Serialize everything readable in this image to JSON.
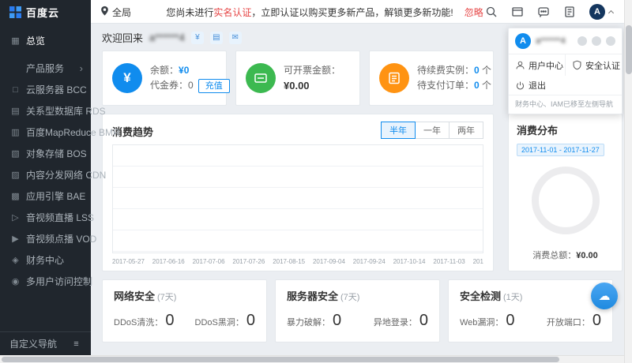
{
  "topbar": {
    "logo": "百度云",
    "region": "全局",
    "notice": {
      "prefix": "您尚未进行",
      "link": "实名认证",
      "body": "，立即认证以购买更多新产品，解锁更多新功能!",
      "ignore": "忽略"
    },
    "avatar": "A"
  },
  "sidebar": {
    "items": [
      {
        "icon": "▦",
        "label": "总览"
      },
      {
        "icon": "",
        "label": "产品服务",
        "chevron": "›"
      },
      {
        "icon": "□",
        "label": "云服务器 BCC"
      },
      {
        "icon": "▤",
        "label": "关系型数据库 RDS"
      },
      {
        "icon": "▥",
        "label": "百度MapReduce BMR"
      },
      {
        "icon": "▧",
        "label": "对象存储 BOS"
      },
      {
        "icon": "▨",
        "label": "内容分发网络 CDN"
      },
      {
        "icon": "▩",
        "label": "应用引擎 BAE"
      },
      {
        "icon": "▷",
        "label": "音视频直播 LSS"
      },
      {
        "icon": "▶",
        "label": "音视频点播 VOD"
      },
      {
        "icon": "◈",
        "label": "财务中心"
      },
      {
        "icon": "◉",
        "label": "多用户访问控制"
      }
    ],
    "footer": {
      "label": "自定义导航",
      "icon": "≡"
    }
  },
  "welcome": {
    "greeting": "欢迎回来",
    "username": "a******4"
  },
  "user_menu": {
    "avatar": "A",
    "username": "a******4",
    "items": {
      "user_center": "用户中心",
      "security": "安全认证",
      "logout": "退出"
    },
    "note": "财务中心、IAM已移至左侧导航"
  },
  "stats": {
    "balance": {
      "currency_icon": "¥",
      "label": "余额：",
      "value": "¥0",
      "voucher_label": "代金券：",
      "voucher_value": "0",
      "recharge": "充值"
    },
    "invoice": {
      "label": "可开票金额：",
      "value": "¥0.00"
    },
    "renew": {
      "label1": "待续费实例：",
      "value1": "0",
      "unit1": "个",
      "label2": "待支付订单：",
      "value2": "0",
      "unit2": "个"
    }
  },
  "trend": {
    "title": "消费趋势",
    "tabs": [
      "半年",
      "一年",
      "两年"
    ],
    "x_labels": [
      "2017-05-27",
      "2017-06-16",
      "2017-07-06",
      "2017-07-26",
      "2017-08-15",
      "2017-09-04",
      "2017-09-24",
      "2017-10-14",
      "2017-11-03",
      "201"
    ]
  },
  "distribution": {
    "title": "消费分布",
    "date_range": "2017-11-01 - 2017-11-27",
    "total_label": "消费总额：",
    "total_value": "¥0.00"
  },
  "security": {
    "cards": [
      {
        "title": "网络安全",
        "period": "(7天)",
        "stats": [
          {
            "label": "DDoS清洗：",
            "value": "0"
          },
          {
            "label": "DDoS黑洞：",
            "value": "0"
          }
        ]
      },
      {
        "title": "服务器安全",
        "period": "(7天)",
        "stats": [
          {
            "label": "暴力破解：",
            "value": "0"
          },
          {
            "label": "异地登录：",
            "value": "0"
          }
        ]
      },
      {
        "title": "安全检测",
        "period": "(1天)",
        "stats": [
          {
            "label": "Web漏洞：",
            "value": "0"
          },
          {
            "label": "开放端口：",
            "value": "0"
          }
        ]
      }
    ]
  },
  "colors": {
    "accent": "#108cee",
    "danger": "#e64545",
    "green": "#3cb950",
    "orange": "#ff9312",
    "sidebar_bg": "#20262d"
  }
}
